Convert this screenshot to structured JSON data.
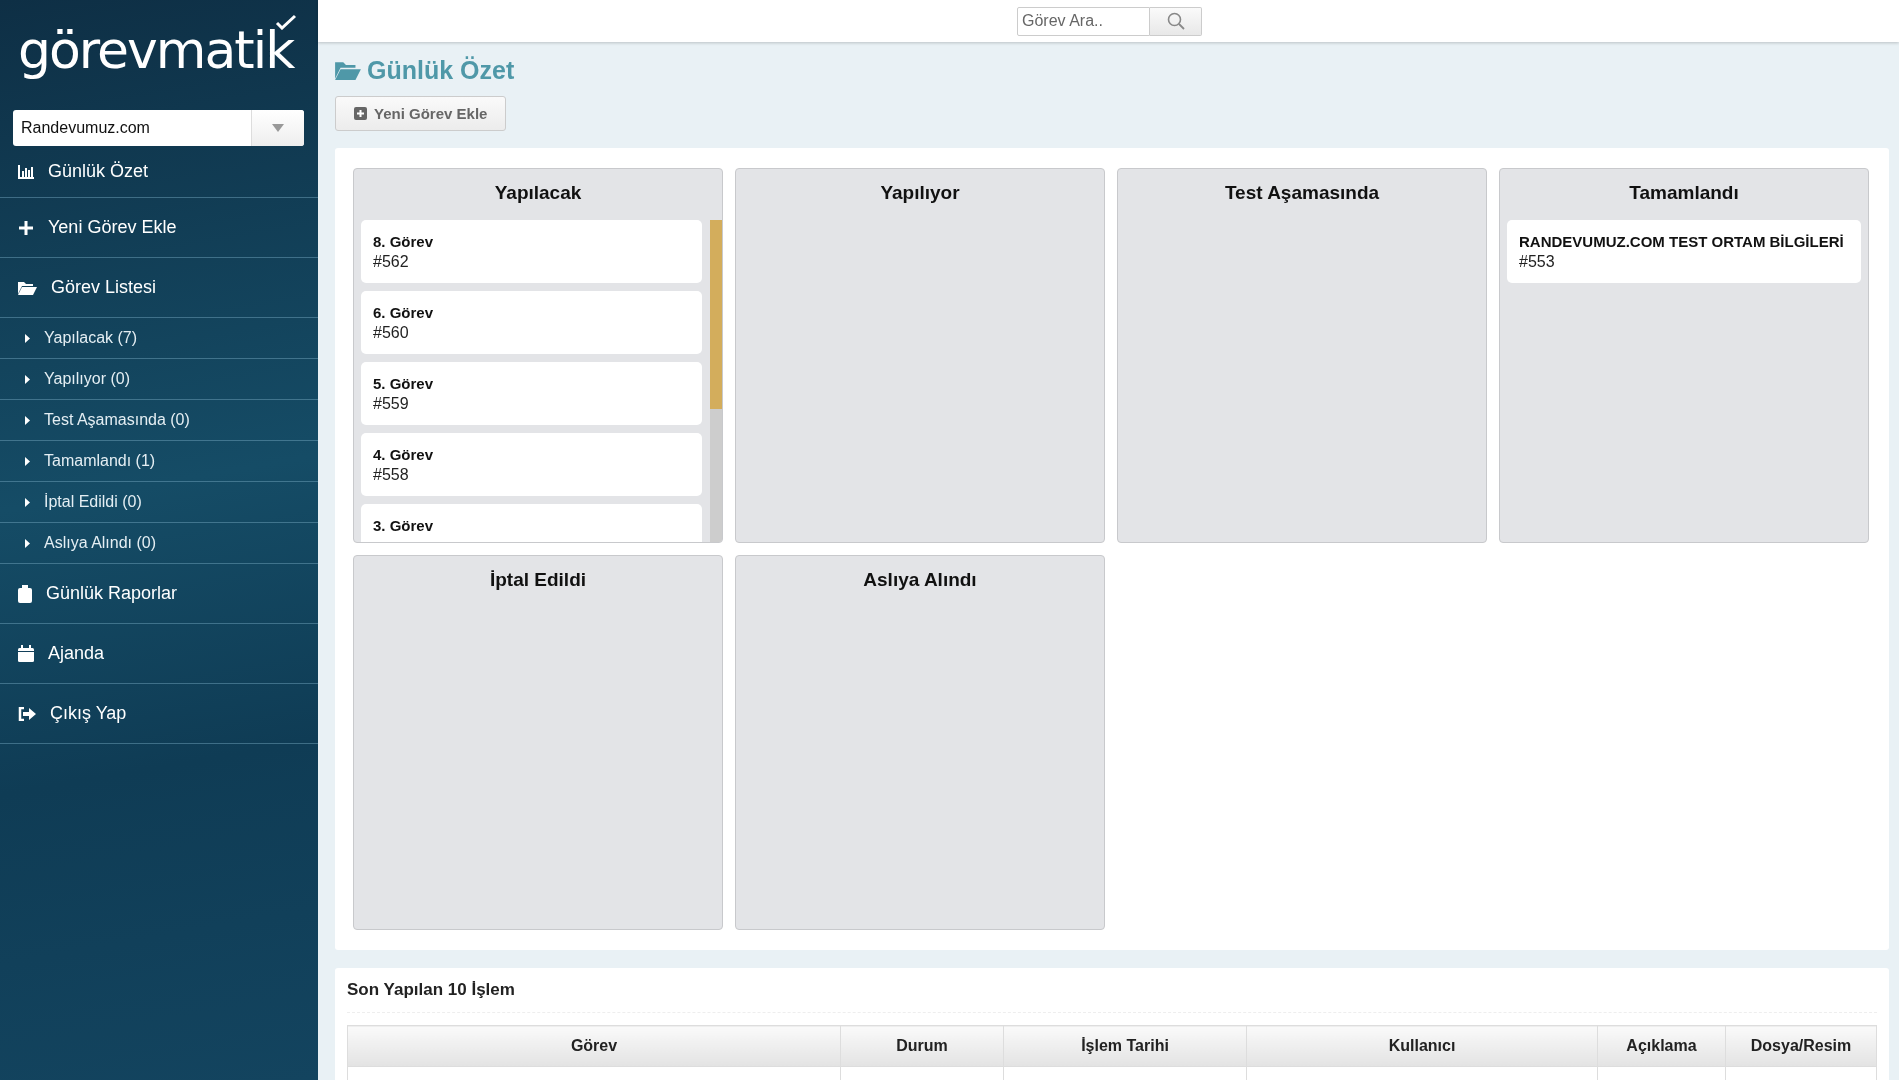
{
  "sidebar": {
    "logo": "görevmatik",
    "project_select": {
      "value": "Randevumuz.com"
    },
    "items": [
      {
        "kind": "main",
        "label": "Günlük Özet"
      },
      {
        "kind": "main",
        "label": "Yeni Görev Ekle"
      },
      {
        "kind": "main",
        "label": "Görev Listesi"
      },
      {
        "kind": "sub",
        "label": "Yapılacak (7)"
      },
      {
        "kind": "sub",
        "label": "Yapılıyor (0)"
      },
      {
        "kind": "sub",
        "label": "Test Aşamasında (0)"
      },
      {
        "kind": "sub",
        "label": "Tamamlandı (1)"
      },
      {
        "kind": "sub",
        "label": "İptal Edildi (0)"
      },
      {
        "kind": "sub",
        "label": "Aslıya Alındı (0)"
      },
      {
        "kind": "main",
        "label": "Günlük Raporlar"
      },
      {
        "kind": "main",
        "label": "Ajanda"
      },
      {
        "kind": "main",
        "label": "Çıkış Yap"
      }
    ]
  },
  "search": {
    "placeholder": "Görev Ara.."
  },
  "page_title": "Günlük Özet",
  "add_button": "Yeni Görev Ekle",
  "board": {
    "columns": [
      {
        "title": "Yapılacak",
        "scrollable": true,
        "cards": [
          {
            "title": "8. Görev",
            "number": "#562"
          },
          {
            "title": "6. Görev",
            "number": "#560"
          },
          {
            "title": "5. Görev",
            "number": "#559"
          },
          {
            "title": "4. Görev",
            "number": "#558"
          },
          {
            "title": "3. Görev"
          }
        ]
      },
      {
        "title": "Yapılıyor",
        "scrollable": false
      },
      {
        "title": "Test Aşamasında",
        "scrollable": false
      },
      {
        "title": "Tamamlandı",
        "scrollable": false,
        "cards": [
          {
            "title": "RANDEVUMUZ.COM TEST ORTAM BİLGİLERİ",
            "number": "#553"
          }
        ]
      },
      {
        "title": "İptal Edildi",
        "scrollable": false
      },
      {
        "title": "Aslıya Alındı",
        "scrollable": false
      }
    ]
  },
  "recent": {
    "title": "Son Yapılan 10 İşlem",
    "table": {
      "columns": [
        "Görev",
        "Durum",
        "İşlem Tarihi",
        "Kullanıcı",
        "Açıklama",
        "Dosya/Resim"
      ]
    }
  }
}
